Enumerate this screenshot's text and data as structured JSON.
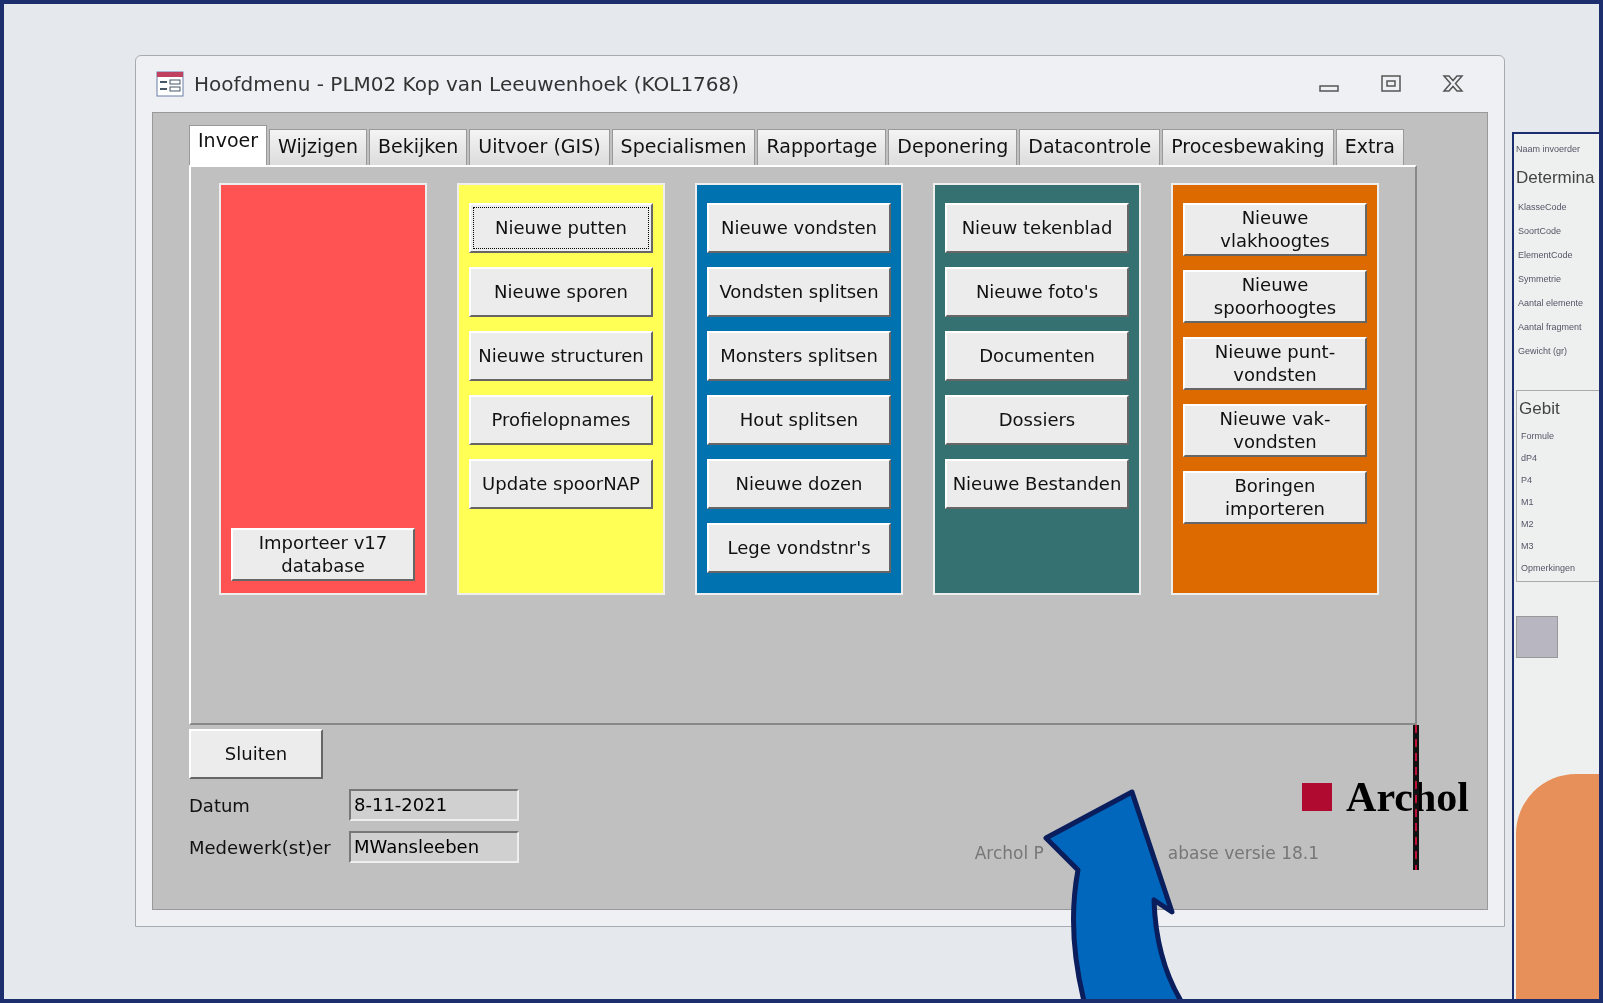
{
  "window": {
    "title": "Hoofdmenu - PLM02 Kop van Leeuwenhoek (KOL1768)"
  },
  "tabs": [
    {
      "label": "Invoer",
      "selected": true
    },
    {
      "label": "Wijzigen",
      "selected": false
    },
    {
      "label": "Bekijken",
      "selected": false
    },
    {
      "label": "Uitvoer (GIS)",
      "selected": false
    },
    {
      "label": "Specialismen",
      "selected": false
    },
    {
      "label": "Rapportage",
      "selected": false
    },
    {
      "label": "Deponering",
      "selected": false
    },
    {
      "label": "Datacontrole",
      "selected": false
    },
    {
      "label": "Procesbewaking",
      "selected": false
    },
    {
      "label": "Extra",
      "selected": false
    }
  ],
  "columns": [
    {
      "color": "#ff5252",
      "kind": "bottom",
      "buttons": [
        {
          "label": "Importeer v17 database",
          "focused": false
        }
      ]
    },
    {
      "color": "#ffff55",
      "kind": "top",
      "buttons": [
        {
          "label": "Nieuwe putten",
          "focused": true
        },
        {
          "label": "Nieuwe sporen",
          "focused": false
        },
        {
          "label": "Nieuwe structuren",
          "focused": false
        },
        {
          "label": "Profielopnames",
          "focused": false
        },
        {
          "label": "Update spoorNAP",
          "focused": false
        }
      ]
    },
    {
      "color": "#0072b0",
      "kind": "top",
      "buttons": [
        {
          "label": "Nieuwe vondsten",
          "focused": false
        },
        {
          "label": "Vondsten splitsen",
          "focused": false
        },
        {
          "label": "Monsters splitsen",
          "focused": false
        },
        {
          "label": "Hout splitsen",
          "focused": false
        },
        {
          "label": "Nieuwe dozen",
          "focused": false
        },
        {
          "label": "Lege vondstnr's",
          "focused": false
        }
      ]
    },
    {
      "color": "#367171",
      "kind": "top",
      "buttons": [
        {
          "label": "Nieuw tekenblad",
          "focused": false
        },
        {
          "label": "Nieuwe foto's",
          "focused": false
        },
        {
          "label": "Documenten",
          "focused": false
        },
        {
          "label": "Dossiers",
          "focused": false
        },
        {
          "label": "Nieuwe Bestanden",
          "focused": false
        }
      ]
    },
    {
      "color": "#dc6a00",
      "kind": "top",
      "buttons": [
        {
          "label": "Nieuwe vlakhoogtes",
          "focused": false
        },
        {
          "label": "Nieuwe spoorhoogtes",
          "focused": false
        },
        {
          "label": "Nieuwe punt-vondsten",
          "focused": false
        },
        {
          "label": "Nieuwe vak-vondsten",
          "focused": false
        },
        {
          "label": "Boringen importeren",
          "focused": false
        }
      ]
    }
  ],
  "close_button": "Sluiten",
  "fields": [
    {
      "label": "Datum",
      "value": "8-11-2021"
    },
    {
      "label": "Medewerk(st)er",
      "value": "MWansleeben"
    }
  ],
  "logo": "Archol",
  "version_text": [
    "Archol P",
    "abase versie 18.1"
  ],
  "background_window": {
    "top_label": "Naam invoerder",
    "section_1": "Determina",
    "labels_1": [
      "KlasseCode",
      "SoortCode",
      "ElementCode",
      "Symmetrie",
      "Aantal elemente",
      "Aantal fragment",
      "Gewicht (gr)"
    ],
    "section_2": "Gebit",
    "labels_2": [
      "Formule",
      "dP4",
      "P4",
      "M1",
      "M2",
      "M3",
      "Opmerkingen"
    ]
  }
}
